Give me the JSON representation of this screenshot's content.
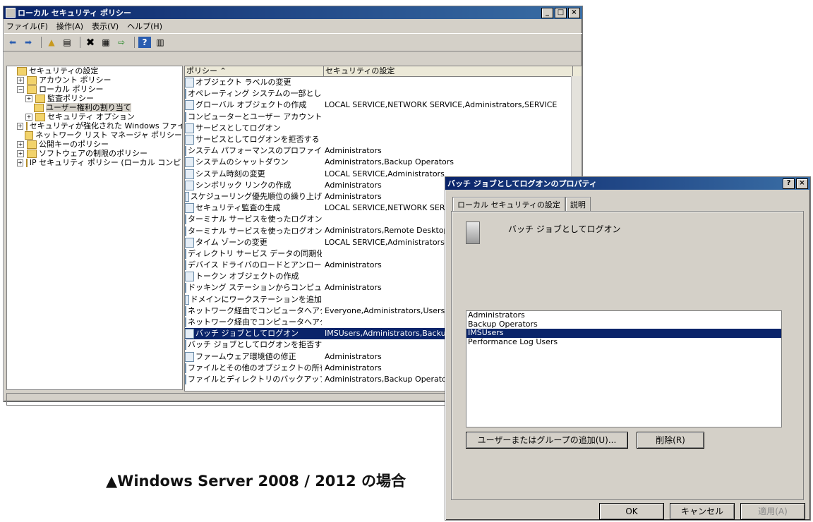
{
  "main_window": {
    "title": "ローカル セキュリティ ポリシー",
    "menu": [
      "ファイル(F)",
      "操作(A)",
      "表示(V)",
      "ヘルプ(H)"
    ],
    "tree": [
      {
        "label": "セキュリティの設定",
        "expander": "",
        "level": 0
      },
      {
        "label": "アカウント ポリシー",
        "expander": "+",
        "level": 1
      },
      {
        "label": "ローカル ポリシー",
        "expander": "−",
        "level": 1
      },
      {
        "label": "監査ポリシー",
        "expander": "+",
        "level": 2
      },
      {
        "label": "ユーザー権利の割り当て",
        "expander": "",
        "level": 2
      },
      {
        "label": "セキュリティ オプション",
        "expander": "+",
        "level": 2
      },
      {
        "label": "セキュリティが強化された Windows ファイア",
        "expander": "+",
        "level": 1
      },
      {
        "label": "ネットワーク リスト マネージャ ポリシー",
        "expander": "",
        "level": 1
      },
      {
        "label": "公開キーのポリシー",
        "expander": "+",
        "level": 1
      },
      {
        "label": "ソフトウェアの制限のポリシー",
        "expander": "+",
        "level": 1
      },
      {
        "label": "IP セキュリティ ポリシー (ローカル コンピュー",
        "expander": "+",
        "level": 1
      }
    ],
    "columns": [
      "ポリシー ⌃",
      "セキュリティの設定"
    ],
    "rows": [
      {
        "policy": "オブジェクト ラベルの変更",
        "setting": ""
      },
      {
        "policy": "オペレーティング システムの一部とし...",
        "setting": ""
      },
      {
        "policy": "グローバル オブジェクトの作成",
        "setting": "LOCAL SERVICE,NETWORK SERVICE,Administrators,SERVICE"
      },
      {
        "policy": "コンピューターとユーザー アカウントに委...",
        "setting": ""
      },
      {
        "policy": "サービスとしてログオン",
        "setting": ""
      },
      {
        "policy": "サービスとしてログオンを拒否する",
        "setting": ""
      },
      {
        "policy": "システム パフォーマンスのプロファイル",
        "setting": "Administrators"
      },
      {
        "policy": "システムのシャットダウン",
        "setting": "Administrators,Backup Operators"
      },
      {
        "policy": "システム時刻の変更",
        "setting": "LOCAL SERVICE,Administrators"
      },
      {
        "policy": "シンボリック リンクの作成",
        "setting": "Administrators"
      },
      {
        "policy": "スケジューリング優先順位の繰り上げ",
        "setting": "Administrators"
      },
      {
        "policy": "セキュリティ監査の生成",
        "setting": "LOCAL SERVICE,NETWORK SERV"
      },
      {
        "policy": "ターミナル サービスを使ったログオンを...",
        "setting": ""
      },
      {
        "policy": "ターミナル サービスを使ったログオンを...",
        "setting": "Administrators,Remote Desktop Us"
      },
      {
        "policy": "タイム ゾーンの変更",
        "setting": "LOCAL SERVICE,Administrators"
      },
      {
        "policy": "ディレクトリ サービス データの同期化",
        "setting": ""
      },
      {
        "policy": "デバイス ドライバのロードとアンロード",
        "setting": "Administrators"
      },
      {
        "policy": "トークン オブジェクトの作成",
        "setting": ""
      },
      {
        "policy": "ドッキング ステーションからコンピュー...",
        "setting": "Administrators"
      },
      {
        "policy": "ドメインにワークステーションを追加",
        "setting": ""
      },
      {
        "policy": "ネットワーク経由でコンピュータへアク...",
        "setting": "Everyone,Administrators,Users,Bac"
      },
      {
        "policy": "ネットワーク経由でコンピュータへアク...",
        "setting": ""
      },
      {
        "policy": "バッチ ジョブとしてログオン",
        "setting": "IMSUsers,Administrators,Backup O",
        "selected": true
      },
      {
        "policy": "バッチ ジョブとしてログオンを拒否する",
        "setting": ""
      },
      {
        "policy": "ファームウェア環境値の修正",
        "setting": "Administrators"
      },
      {
        "policy": "ファイルとその他のオブジェクトの所有...",
        "setting": "Administrators"
      },
      {
        "policy": "ファイルとディレクトリのバックアップ",
        "setting": "Administrators,Backup Operators"
      }
    ]
  },
  "dialog": {
    "title": "バッチ ジョブとしてログオンのプロパティ",
    "tabs": [
      "ローカル セキュリティの設定",
      "説明"
    ],
    "heading": "バッチ ジョブとしてログオン",
    "list": [
      {
        "label": "Administrators"
      },
      {
        "label": "Backup Operators"
      },
      {
        "label": "IMSUsers",
        "selected": true
      },
      {
        "label": "Performance Log Users"
      }
    ],
    "add_button": "ユーザーまたはグループの追加(U)...",
    "remove_button": "削除(R)",
    "ok": "OK",
    "cancel": "キャンセル",
    "apply": "適用(A)"
  },
  "caption": "▲Windows Server 2008 / 2012 の場合"
}
